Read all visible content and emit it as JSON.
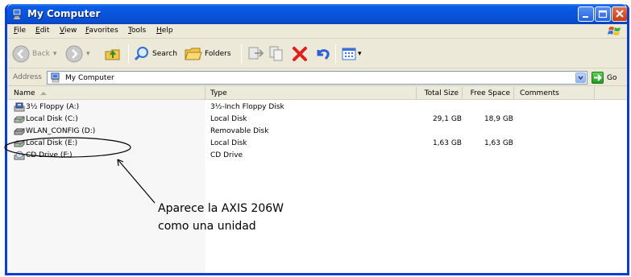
{
  "window": {
    "title": "My Computer"
  },
  "menu": [
    {
      "label": "File",
      "u": "F",
      "rest": "ile"
    },
    {
      "label": "Edit",
      "u": "E",
      "rest": "dit"
    },
    {
      "label": "View",
      "u": "V",
      "rest": "iew"
    },
    {
      "label": "Favorites",
      "u": "F",
      "rest": "avorites",
      "pre": ""
    },
    {
      "label": "Tools",
      "u": "T",
      "rest": "ools"
    },
    {
      "label": "Help",
      "u": "H",
      "rest": "elp"
    }
  ],
  "toolbar": {
    "back_label": "Back",
    "search_label": "Search",
    "folders_label": "Folders"
  },
  "address": {
    "label": "Address",
    "value": "My Computer",
    "go_label": "Go"
  },
  "columns": {
    "name": "Name",
    "type": "Type",
    "total": "Total Size",
    "free": "Free Space",
    "comments": "Comments"
  },
  "rows": [
    {
      "name": "3½ Floppy (A:)",
      "type": "3½-Inch Floppy Disk",
      "total": "",
      "free": "",
      "icon": "floppy-drive-icon"
    },
    {
      "name": "Local Disk (C:)",
      "type": "Local Disk",
      "total": "29,1 GB",
      "free": "18,9 GB",
      "icon": "hard-disk-icon"
    },
    {
      "name": "WLAN_CONFIG (D:)",
      "type": "Removable Disk",
      "total": "",
      "free": "",
      "icon": "removable-disk-icon"
    },
    {
      "name": "Local Disk (E:)",
      "type": "Local Disk",
      "total": "1,63 GB",
      "free": "1,63 GB",
      "icon": "hard-disk-icon"
    },
    {
      "name": "CD Drive (F:)",
      "type": "CD Drive",
      "total": "",
      "free": "",
      "icon": "cd-drive-icon"
    }
  ],
  "annotation": {
    "line1": "Aparece la AXIS 206W",
    "line2": "como una unidad"
  },
  "colors": {
    "titlebar": "#0855dd",
    "window_border": "#0a3fd6",
    "chrome": "#ece9d8",
    "close_button": "#c23c16",
    "go_button": "#229922"
  }
}
